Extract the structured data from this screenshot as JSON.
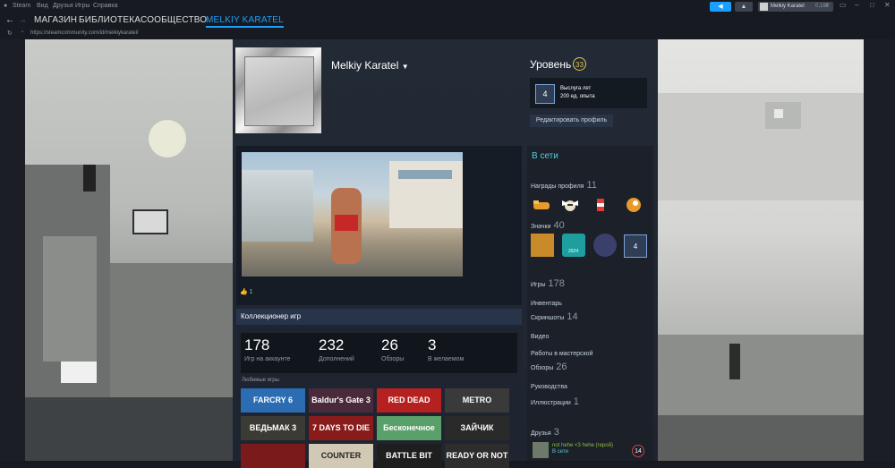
{
  "menubar": {
    "items": [
      "Steam",
      "Вид",
      "Друзья",
      "Игры",
      "Справка"
    ],
    "user": "Melkiy Karatel",
    "wallet": "0,19₴"
  },
  "nav": {
    "store": "МАГАЗИН",
    "library": "БИБЛИОТЕКА",
    "community": "СООБЩЕСТВО",
    "profile": "MELKIY KARATEL"
  },
  "url": "https://steamcommunity.com/id/melkiykaratel/",
  "profile": {
    "name": "Melkiy Karatel"
  },
  "level": {
    "label": "Уровень",
    "value": "33"
  },
  "years_badge": {
    "value": "4",
    "title": "Выслуга лет",
    "xp": "200 ед. опыта"
  },
  "edit_profile": "Редактировать профиль",
  "showcase": {
    "likes": "1"
  },
  "collector": {
    "title": "Коллекционер игр",
    "stats": [
      {
        "value": "178",
        "label": "Игр на аккаунте"
      },
      {
        "value": "232",
        "label": "Дополнений"
      },
      {
        "value": "26",
        "label": "Обзоры"
      },
      {
        "value": "3",
        "label": "В желаемом"
      }
    ],
    "fav_label": "Любимые игры",
    "games": [
      {
        "title": "FARCRY 6",
        "color": "#2b6cb3"
      },
      {
        "title": "Baldur's Gate 3",
        "color": "#4a2a3a"
      },
      {
        "title": "RED DEAD REDEMPTION II",
        "color": "#b52120"
      },
      {
        "title": "METRO",
        "color": "#3a3a3a"
      },
      {
        "title": "ВЕДЬМАК 3",
        "color": "#3b3a34"
      },
      {
        "title": "7 DAYS TO DIE",
        "color": "#8a1b1b"
      },
      {
        "title": "Бесконечное лето",
        "color": "#5aa06a"
      },
      {
        "title": "ЗАЙЧИК",
        "color": "#2a2a2a"
      },
      {
        "title": "",
        "color": "#7a1a1a"
      },
      {
        "title": "COUNTER STRIKE",
        "color": "#d2c9b5"
      },
      {
        "title": "BATTLE BIT",
        "color": "#1e1e1e"
      },
      {
        "title": "READY OR NOT",
        "color": "#2d2d2d"
      }
    ]
  },
  "status": "В сети",
  "awards": {
    "label": "Награды профиля",
    "count": "11"
  },
  "badges": {
    "label": "Значки",
    "count": "40",
    "year_badge": "4",
    "badge_2024": "2024"
  },
  "links": [
    {
      "label": "Игры",
      "count": "178"
    },
    {
      "label": "Инвентарь",
      "count": ""
    },
    {
      "label": "Скриншоты",
      "count": "14"
    },
    {
      "label": "Видео",
      "count": ""
    },
    {
      "label": "Работы в мастерской",
      "count": ""
    },
    {
      "label": "Обзоры",
      "count": "26"
    },
    {
      "label": "Руководства",
      "count": ""
    },
    {
      "label": "Иллюстрации",
      "count": "1"
    }
  ],
  "friends": {
    "label": "Друзья",
    "count": "3",
    "friend_name": "not hehe <3 hehe (герой)",
    "friend_status": "В сети",
    "friend_level": "14"
  }
}
